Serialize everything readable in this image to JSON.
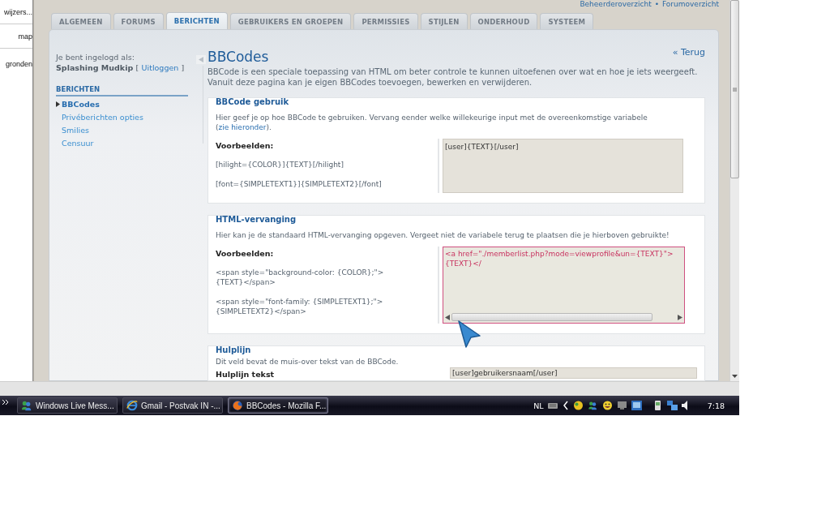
{
  "side_panel": {
    "items": [
      "wijzers...",
      "map",
      "gronden"
    ]
  },
  "header_links": {
    "first": "Beheerderoverzicht",
    "separator": "•",
    "second": "Forumoverzicht"
  },
  "tabs": [
    {
      "label": "ALGEMEEN",
      "selected": false
    },
    {
      "label": "FORUMS",
      "selected": false
    },
    {
      "label": "BERICHTEN",
      "selected": true
    },
    {
      "label": "GEBRUIKERS EN GROEPEN",
      "selected": false
    },
    {
      "label": "PERMISSIES",
      "selected": false
    },
    {
      "label": "STIJLEN",
      "selected": false
    },
    {
      "label": "ONDERHOUD",
      "selected": false
    },
    {
      "label": "SYSTEEM",
      "selected": false
    }
  ],
  "sidebar": {
    "login_label": "Je bent ingelogd als:",
    "username": "Splashing Mudkip",
    "bracket_open": "[",
    "logout": "Uitloggen",
    "bracket_close": "]",
    "section_title": "BERICHTEN",
    "items": [
      {
        "label": "BBCodes",
        "selected": true
      },
      {
        "label": "Privéberichten opties",
        "selected": false
      },
      {
        "label": "Smilies",
        "selected": false
      },
      {
        "label": "Censuur",
        "selected": false
      }
    ]
  },
  "main": {
    "title": "BBCodes",
    "back_link": "« Terug",
    "description": "BBCode is een speciale toepassing van HTML om beter controle te kunnen uitoefenen over wat en hoe je iets weergeeft. Vanuit deze pagina kan je eigen BBCodes toevoegen, bewerken en verwijderen."
  },
  "sections": [
    {
      "kind": "examples",
      "title": "BBCode gebruik",
      "explain": "Hier geef je op hoe BBCode te gebruiken. Vervang eender welke willekeurige input met de overeenkomstige variabele (",
      "explain_link": "zie hieronder",
      "explain_end": ").",
      "examples_label": "Voorbeelden:",
      "examples": [
        "[hilight={COLOR}]{TEXT}[/hilight]",
        "[font={SIMPLETEXT1}]{SIMPLETEXT2}[/font]"
      ],
      "textarea": {
        "value": "[user]{TEXT}[/user]",
        "focused": false
      }
    },
    {
      "kind": "examples",
      "title": "HTML-vervanging",
      "explain": "Hier kan je de standaard HTML-vervanging opgeven. Vergeet niet de variabele terug te plaatsen die je hierboven gebruikte!",
      "examples_label": "Voorbeelden:",
      "examples": [
        "<span style=\"background-color: {COLOR};\">{TEXT}</span>",
        "<span style=\"font-family: {SIMPLETEXT1};\">{SIMPLETEXT2}</span>"
      ],
      "textarea": {
        "value": "<a href=\"./memberlist.php?mode=viewprofile&un={TEXT}\">{TEXT}</",
        "focused": true
      }
    },
    {
      "kind": "field",
      "title": "Hulplijn",
      "explain": "Dit veld bevat de muis-over tekst van de BBCode.",
      "field_label": "Hulplijn tekst",
      "field_value": "[user]gebruikersnaam[/user]"
    }
  ],
  "taskbar": {
    "tasks": [
      {
        "label": "Windows Live Mess...",
        "selected": false
      },
      {
        "label": "Gmail - Postvak IN -...",
        "selected": false
      },
      {
        "label": "BBCodes - Mozilla F...",
        "selected": true
      }
    ],
    "language": "NL",
    "clock": "7:18"
  }
}
